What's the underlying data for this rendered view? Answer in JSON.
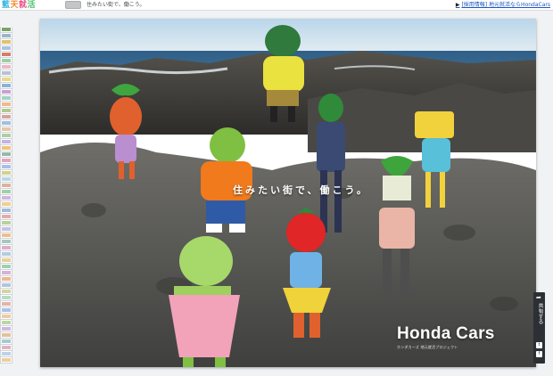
{
  "header": {
    "logo": [
      "藍",
      "天",
      "就",
      "活"
    ],
    "sound_toggle": "sound-toggle",
    "tagline": "住みたい街で、働こう。",
    "external_link": "[採用情報] 地元就活ならHondaCars",
    "external_link_icon": "play-icon"
  },
  "rail": {
    "thumb_colors": [
      "#7aa36b",
      "#9bb6c9",
      "#e3c16a",
      "#a8c4de",
      "#d97a6c",
      "#9ad0a2",
      "#f0b5c7",
      "#b7c3d1",
      "#e9d78a",
      "#8fb0d8",
      "#c9a0d6",
      "#a3d1c5",
      "#f2b98a",
      "#b0c98d",
      "#d8a2a2",
      "#9cc0e0",
      "#e6c7a3",
      "#a7d0a3",
      "#c4b3e6",
      "#f0c37b",
      "#97b9a6",
      "#e4a3bd",
      "#a8bfe8",
      "#d6d08a",
      "#b8d6e8",
      "#e0b09a",
      "#a2cfa8",
      "#cfb7e0",
      "#f0d08c",
      "#9fbcd9",
      "#e5aab0",
      "#b7d39d",
      "#c7c0e8",
      "#eebf88",
      "#a4c8c0",
      "#dcaec8",
      "#b3cbe3",
      "#e9ce95",
      "#9fd0b2",
      "#d2b2d6",
      "#f1b68f",
      "#aec6df",
      "#d4d5a0",
      "#b4dbc8",
      "#e7b3a8",
      "#a9c1e4",
      "#f0cba0",
      "#b9d7a6",
      "#cdb8e2",
      "#e3c293",
      "#a3cbd6",
      "#dfb3bf",
      "#bcd2e8",
      "#ebd09b"
    ]
  },
  "hero": {
    "copy": "住みたい街で、働こう。",
    "brand": "Honda Cars",
    "brand_sub": "ホンダカーズ 地元就活プロジェクト"
  },
  "share": {
    "label": "共有する",
    "share_icon": "share-arrow-icon",
    "buttons": [
      {
        "icon": "twitter-icon",
        "glyph": "t"
      },
      {
        "icon": "facebook-icon",
        "glyph": "f"
      }
    ]
  },
  "colors": {
    "sky": "#cfe4f0",
    "sea": "#3d6f93",
    "rock": "#5b5f5d",
    "accent_logo": "#38b6e0",
    "share_panel": "#2c2f34"
  }
}
